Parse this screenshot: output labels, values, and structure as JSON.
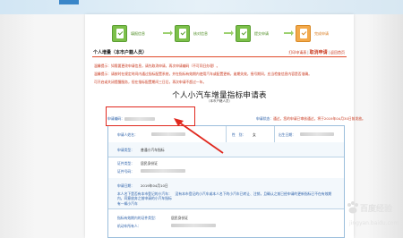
{
  "steps": [
    {
      "label": "填报信息",
      "active": false
    },
    {
      "label": "核对信息",
      "active": false
    },
    {
      "label": "提交申请",
      "active": false
    },
    {
      "label": "完成申请",
      "active": true
    }
  ],
  "header": {
    "title": "个人增量（本市户籍人员）",
    "link_left": "打印申请表",
    "cancel_label": "取消申请",
    "link_right": "返回首页"
  },
  "notices": [
    {
      "prefix": "温馨提示：",
      "text": "如需要更改申请信息，请先取消申请，再次申请编码（不可同日办理）。"
    },
    {
      "prefix": "温馨提示：",
      "text": "请按时在规定时间内通过指标配置系统，并在指标有效期内使用汽车或配置更新，逾期失效，摇号期间，应当检查信息内容是否准确。"
    },
    {
      "prefix": "",
      "text": "可开启或关闭提醒服务，但在指标配置期间三日后，再次申请不超过一年。"
    }
  ],
  "title": "个人小汽车增量指标申请表",
  "subtitle": "（本市户籍人员）",
  "info": {
    "code_label": "申请编码：",
    "status_label": "申请状态：",
    "status_value": "通过",
    "status_text": "您的申请已审核通过，将于2019年04月30日前发放。"
  },
  "form": {
    "applicant_label": "申请人姓名：",
    "gender_label": "性　别：",
    "gender_value": "女",
    "birth_label": "出生日期：",
    "car_type_label": "申请类型：",
    "car_type_value": "普通小汽车指标",
    "id_type_label": "证件类型：",
    "id_type_value": "居民身份证",
    "id_no_label": "证件号码：",
    "date_label": "申请日期：",
    "date_value": "2019年04月10日",
    "statement_a": "本人名下是否有本市登记的小汽车：　没有本市登记的小汽车或本人名下的小汽车已转让、注销，且确认之前已经申请的更新指标已不在有效期内，同意放弃之前申请的小汽车指标",
    "statement_b": "有一辆小汽车",
    "holder_type_label": "指标有效期内的证件类型：",
    "holder_type_value": "居民身份证",
    "holder_no_label": "机动车所有人："
  },
  "watermark": {
    "cn": "百度经验",
    "url": "jingyan.baidu.com"
  },
  "colors": {
    "accent_red": "#e0281e",
    "step_green": "#7cc04a",
    "step_orange": "#f3a94a",
    "link_blue": "#2a5fa8"
  }
}
